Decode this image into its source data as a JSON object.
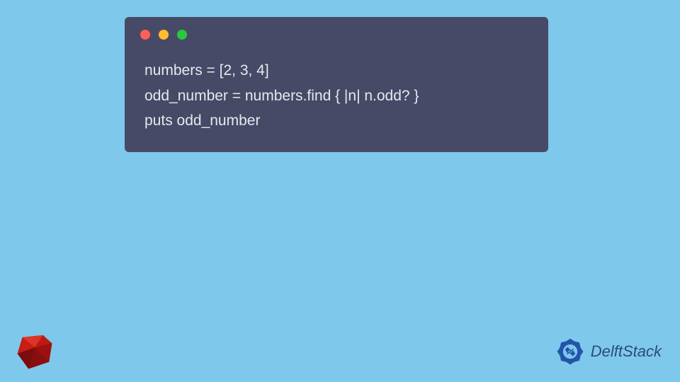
{
  "code": {
    "lines": [
      "numbers = [2, 3, 4]",
      "odd_number = numbers.find { |n| n.odd? }",
      "puts odd_number"
    ]
  },
  "window_controls": {
    "dots": [
      "red",
      "yellow",
      "green"
    ]
  },
  "branding": {
    "ruby_logo": "ruby-gem",
    "delftstack_name": "DelftStack"
  },
  "colors": {
    "background": "#7ec8eb",
    "code_background": "#474a66",
    "code_text": "#e8e8ee",
    "brand_text": "#2a4d7a"
  }
}
